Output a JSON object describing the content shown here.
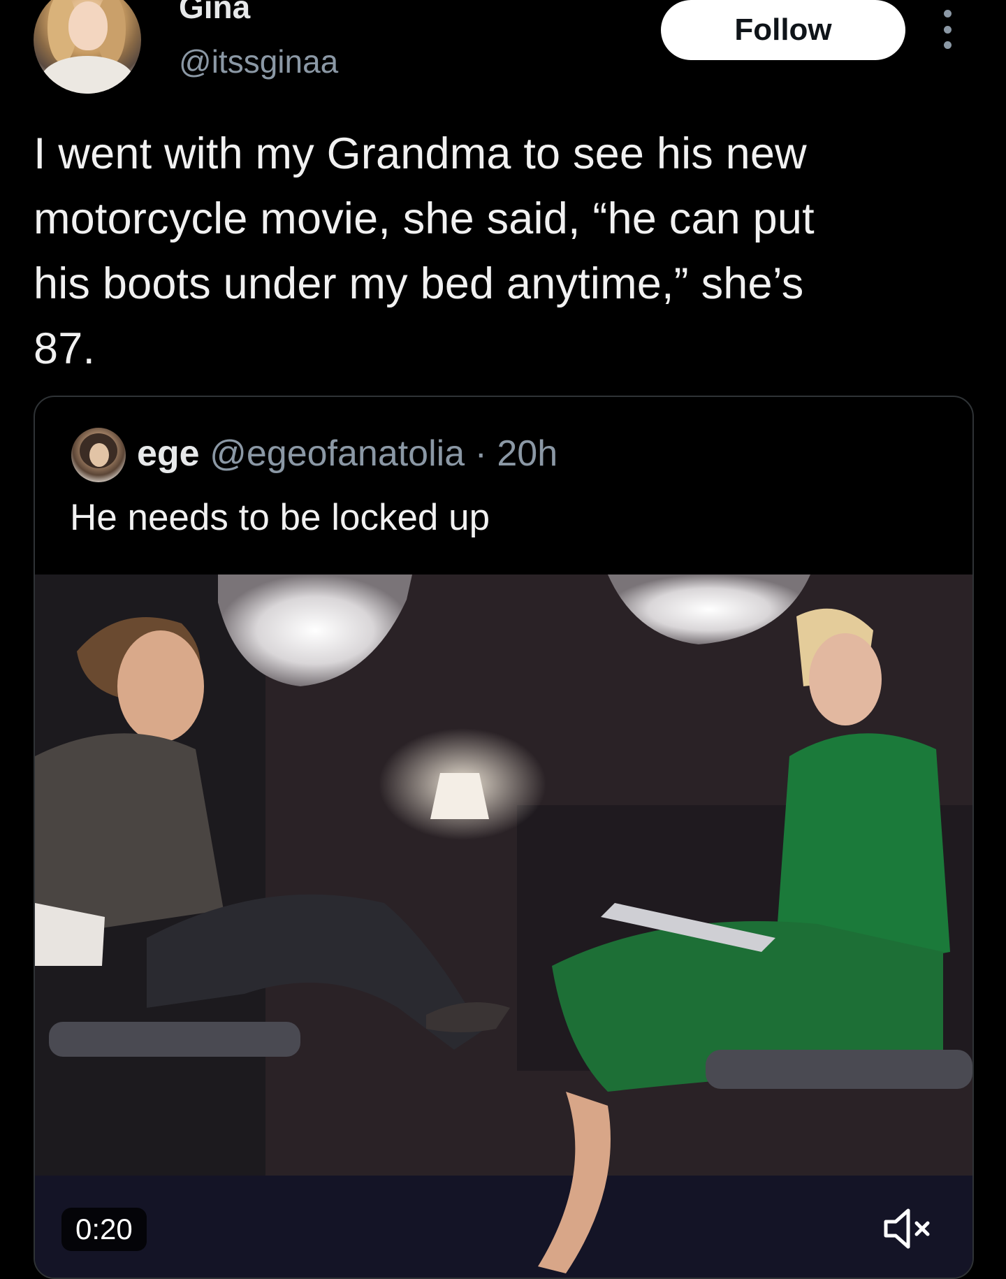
{
  "author": {
    "display_name": "Gina",
    "handle": "@itssginaa",
    "avatar_icon": "profile-photo"
  },
  "actions": {
    "follow_label": "Follow",
    "more_icon": "more-vertical-icon"
  },
  "tweet": {
    "text_lines": [
      "I went with my Grandma to see his new",
      "motorcycle movie, she said, “he can put",
      "his boots under my bed anytime,” she’s",
      "87."
    ]
  },
  "quote": {
    "name": "ege",
    "handle": "@egeofanatolia",
    "separator": " · ",
    "time": "20h",
    "text": "He needs to be locked up",
    "media": {
      "type": "video",
      "duration": "0:20",
      "mute_icon": "volume-muted-icon"
    }
  },
  "colors": {
    "background": "#000000",
    "text_primary": "#e7e9ea",
    "text_secondary": "#8b98a5",
    "border": "#2f3336",
    "follow_bg": "#ffffff"
  }
}
